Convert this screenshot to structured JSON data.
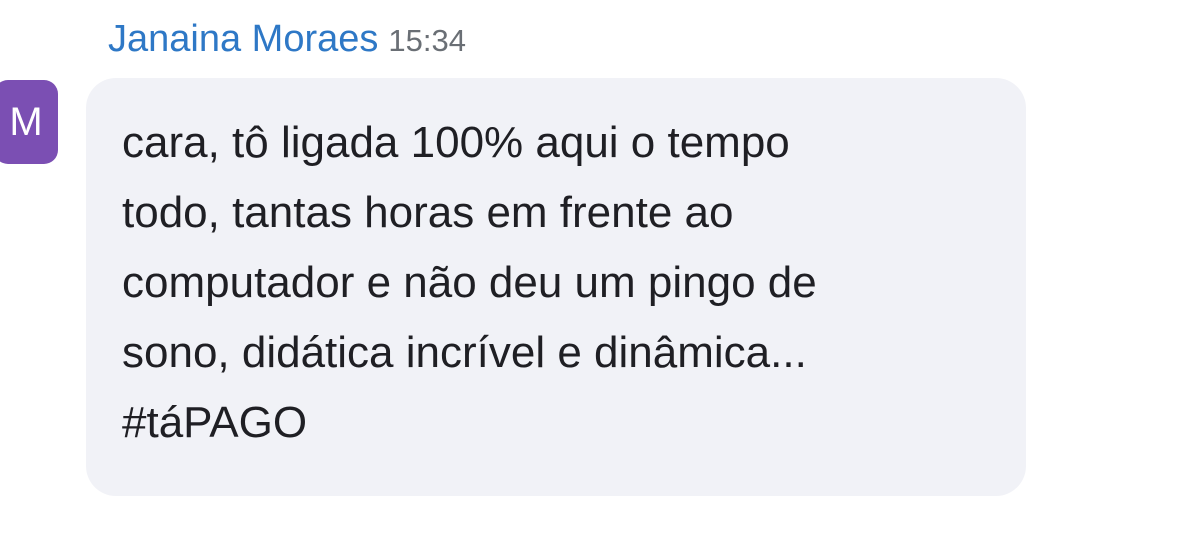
{
  "message": {
    "avatar_initial": "M",
    "sender_name": "Janaina Moraes",
    "time": "15:34",
    "text": "cara, tô ligada 100% aqui o tempo\ntodo, tantas horas em frente ao\ncomputador e não deu um pingo de\nsono, didática incrível e dinâmica...\n#táPAGO"
  },
  "colors": {
    "sender_name": "#2e78c6",
    "avatar_bg": "#7b4fb3",
    "bubble_bg": "#f1f2f7"
  }
}
